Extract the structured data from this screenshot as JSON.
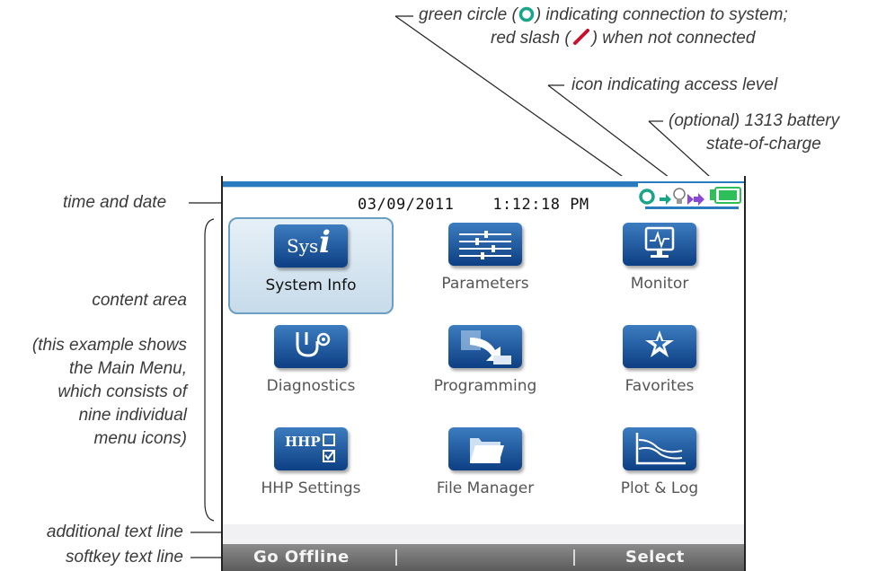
{
  "annotations": {
    "connection_line1_a": "green circle (",
    "connection_line1_b": ") indicating connection to system;",
    "connection_line2_a": "red slash (",
    "connection_line2_b": ") when not connected",
    "access_level": "icon indicating access level",
    "battery_line1": "(optional) 1313 battery",
    "battery_line2": "state-of-charge",
    "time_and_date": "time and date",
    "content_area": "content area",
    "content_note_1": "(this example shows",
    "content_note_2": "the Main Menu,",
    "content_note_3": "which consists of",
    "content_note_4": "nine individual",
    "content_note_5": "menu icons)",
    "additional_text_line": "additional text line",
    "softkey_text_line": "softkey text line"
  },
  "screen": {
    "date": "03/09/2011",
    "time": "1:12:18 PM",
    "menu_items": [
      {
        "label": "System Info",
        "icon": "system-info-icon",
        "selected": true
      },
      {
        "label": "Parameters",
        "icon": "parameters-icon",
        "selected": false
      },
      {
        "label": "Monitor",
        "icon": "monitor-icon",
        "selected": false
      },
      {
        "label": "Diagnostics",
        "icon": "stethoscope-icon",
        "selected": false
      },
      {
        "label": "Programming",
        "icon": "programming-icon",
        "selected": false
      },
      {
        "label": "Favorites",
        "icon": "star-icon",
        "selected": false
      },
      {
        "label": "HHP Settings",
        "icon": "hhp-settings-icon",
        "selected": false
      },
      {
        "label": "File Manager",
        "icon": "folder-icon",
        "selected": false
      },
      {
        "label": "Plot & Log",
        "icon": "plot-icon",
        "selected": false
      }
    ],
    "icon_texts": {
      "sys": "Sys",
      "sys_i": "i",
      "hhp": "HHP"
    },
    "softkeys": {
      "left": "Go Offline",
      "middle": "",
      "right": "Select"
    }
  },
  "colors": {
    "accent_blue": "#2a7bbf",
    "connection_green": "#1aa58a",
    "not_connected_red": "#c8102e",
    "battery_green": "#2fbf5a"
  }
}
